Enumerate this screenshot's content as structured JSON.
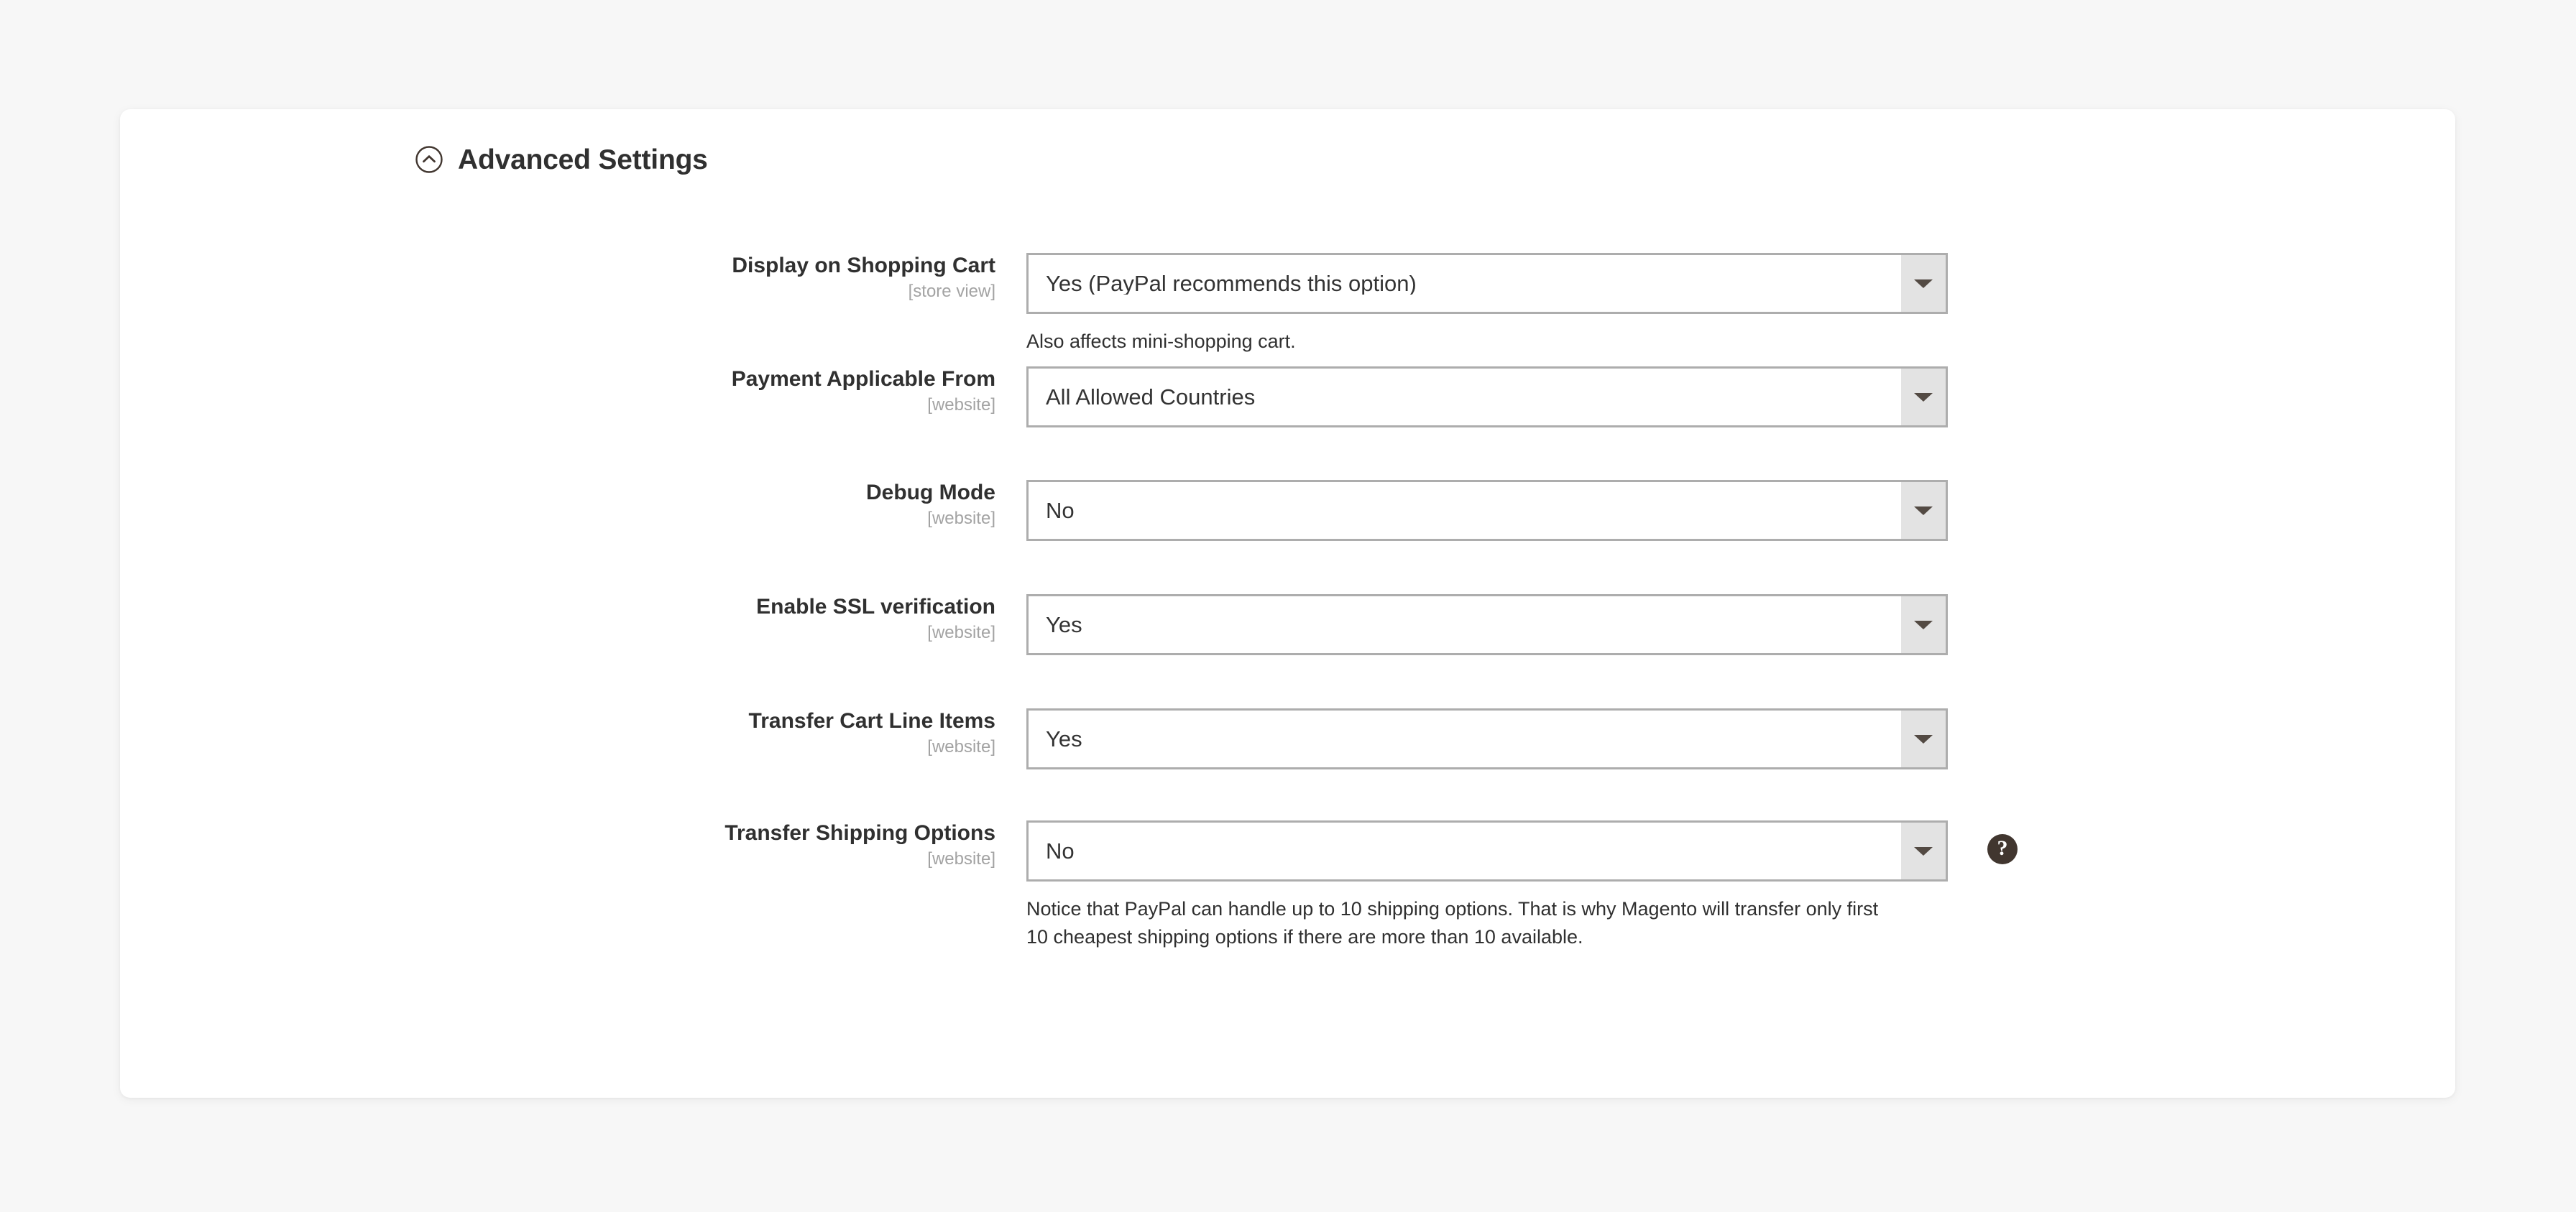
{
  "panel": {
    "section": {
      "title": "Advanced Settings",
      "collapse_icon": "chevron-up-circle-icon",
      "expanded": true
    },
    "fields": [
      {
        "label": "Display on Shopping Cart",
        "scope": "[store view]",
        "value": "Yes (PayPal recommends this option)",
        "note": "Also affects mini-shopping cart.",
        "help": null
      },
      {
        "label": "Payment Applicable From",
        "scope": "[website]",
        "value": "All Allowed Countries",
        "note": null,
        "help": null
      },
      {
        "label": "Debug Mode",
        "scope": "[website]",
        "value": "No",
        "note": null,
        "help": null
      },
      {
        "label": "Enable SSL verification",
        "scope": "[website]",
        "value": "Yes",
        "note": null,
        "help": null
      },
      {
        "label": "Transfer Cart Line Items",
        "scope": "[website]",
        "value": "Yes",
        "note": null,
        "help": null
      },
      {
        "label": "Transfer Shipping Options",
        "scope": "[website]",
        "value": "No",
        "note": "Notice that PayPal can handle up to 10 shipping options. That is why Magento will transfer only first 10 cheapest shipping options if there are more than 10 available.",
        "help": "?"
      }
    ]
  },
  "colors": {
    "page_background": "#f7f7f7",
    "panel_background": "#ffffff",
    "label_text": "#303030",
    "scope_text": "#a3a3a3",
    "select_border": "#adadad",
    "select_arrow_button": "#e3e3e3",
    "select_arrow_glyph": "#534a43",
    "help_icon_background": "#41362f",
    "note_text": "#303030"
  }
}
